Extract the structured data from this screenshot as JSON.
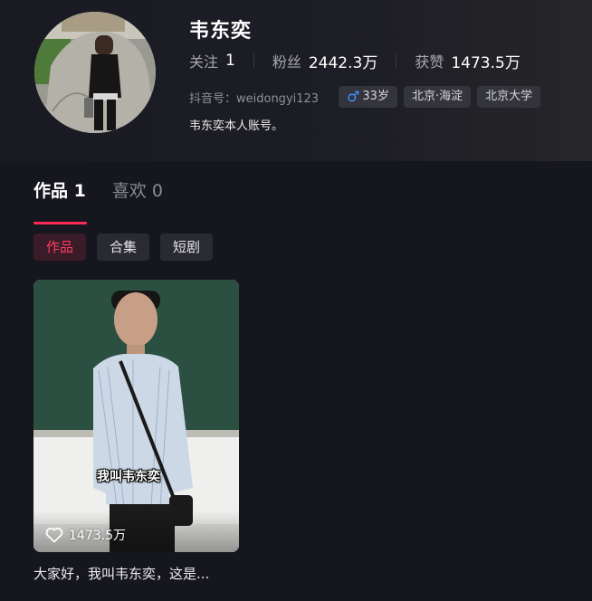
{
  "profile": {
    "nickname": "韦东奕",
    "stats": [
      {
        "label": "关注",
        "value": "1"
      },
      {
        "label": "粉丝",
        "value": "2442.3万"
      },
      {
        "label": "获赞",
        "value": "1473.5万"
      }
    ],
    "douyin_id": "抖音号：weidongyi123",
    "tags": {
      "age": "33岁",
      "location": "北京·海淀",
      "school": "北京大学"
    },
    "bio": "韦东奕本人账号。"
  },
  "tabs": [
    {
      "label": "作品 1",
      "active": true
    },
    {
      "label": "喜欢 0",
      "active": false
    }
  ],
  "chips": [
    {
      "label": "作品",
      "active": true
    },
    {
      "label": "合集",
      "active": false
    },
    {
      "label": "短剧",
      "active": false
    }
  ],
  "videos": [
    {
      "overlay_caption": "我叫韦东奕",
      "likes": "1473.5万",
      "title": "大家好，我叫韦东奕，这是..."
    }
  ],
  "colors": {
    "accent": "#fe2c55",
    "background": "#16161f",
    "male_icon": "#3d94ff"
  },
  "icons": {
    "gender": "male-icon",
    "likes": "heart-outline-icon"
  }
}
